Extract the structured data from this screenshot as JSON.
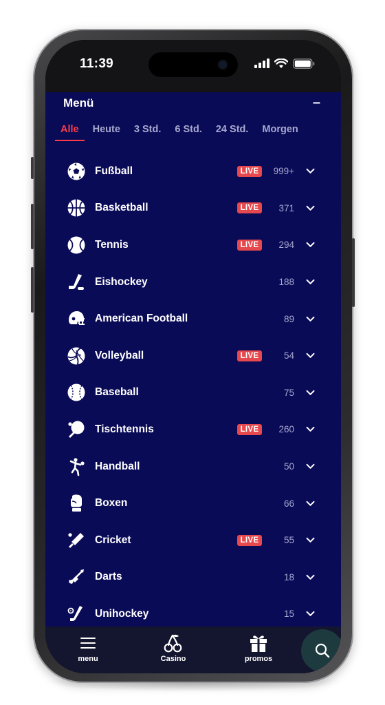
{
  "status_bar": {
    "time": "11:39"
  },
  "menu": {
    "title": "Menü",
    "collapse_symbol": "–"
  },
  "filters": [
    "Alle",
    "Heute",
    "3 Std.",
    "6 Std.",
    "24 Std.",
    "Morgen"
  ],
  "active_filter": "Alle",
  "live_label": "LIVE",
  "colors": {
    "background": "#0a0b57",
    "accent": "#ff3b45",
    "live_badge": "#e5484d",
    "muted_text": "#a7a9cf",
    "tabbar": "#14152e"
  },
  "sports": [
    {
      "name": "Fußball",
      "live": true,
      "count": "999+",
      "icon": "soccer-ball-icon"
    },
    {
      "name": "Basketball",
      "live": true,
      "count": "371",
      "icon": "basketball-icon"
    },
    {
      "name": "Tennis",
      "live": true,
      "count": "294",
      "icon": "tennis-ball-icon"
    },
    {
      "name": "Eishockey",
      "live": false,
      "count": "188",
      "icon": "hockey-stick-icon"
    },
    {
      "name": "American Football",
      "live": false,
      "count": "89",
      "icon": "football-helmet-icon"
    },
    {
      "name": "Volleyball",
      "live": true,
      "count": "54",
      "icon": "volleyball-icon"
    },
    {
      "name": "Baseball",
      "live": false,
      "count": "75",
      "icon": "baseball-icon"
    },
    {
      "name": "Tischtennis",
      "live": true,
      "count": "260",
      "icon": "ping-pong-paddle-icon"
    },
    {
      "name": "Handball",
      "live": false,
      "count": "50",
      "icon": "handball-player-icon"
    },
    {
      "name": "Boxen",
      "live": false,
      "count": "66",
      "icon": "boxing-glove-icon"
    },
    {
      "name": "Cricket",
      "live": true,
      "count": "55",
      "icon": "cricket-bat-icon"
    },
    {
      "name": "Darts",
      "live": false,
      "count": "18",
      "icon": "dart-icon"
    },
    {
      "name": "Unihockey",
      "live": false,
      "count": "15",
      "icon": "floorball-stick-icon"
    }
  ],
  "tabbar": {
    "menu": {
      "label": "menu",
      "icon": "hamburger-menu-icon"
    },
    "casino": {
      "label": "Casino",
      "icon": "cherries-icon"
    },
    "promos": {
      "label": "promos",
      "icon": "gift-icon"
    },
    "search": {
      "icon": "search-icon"
    }
  }
}
